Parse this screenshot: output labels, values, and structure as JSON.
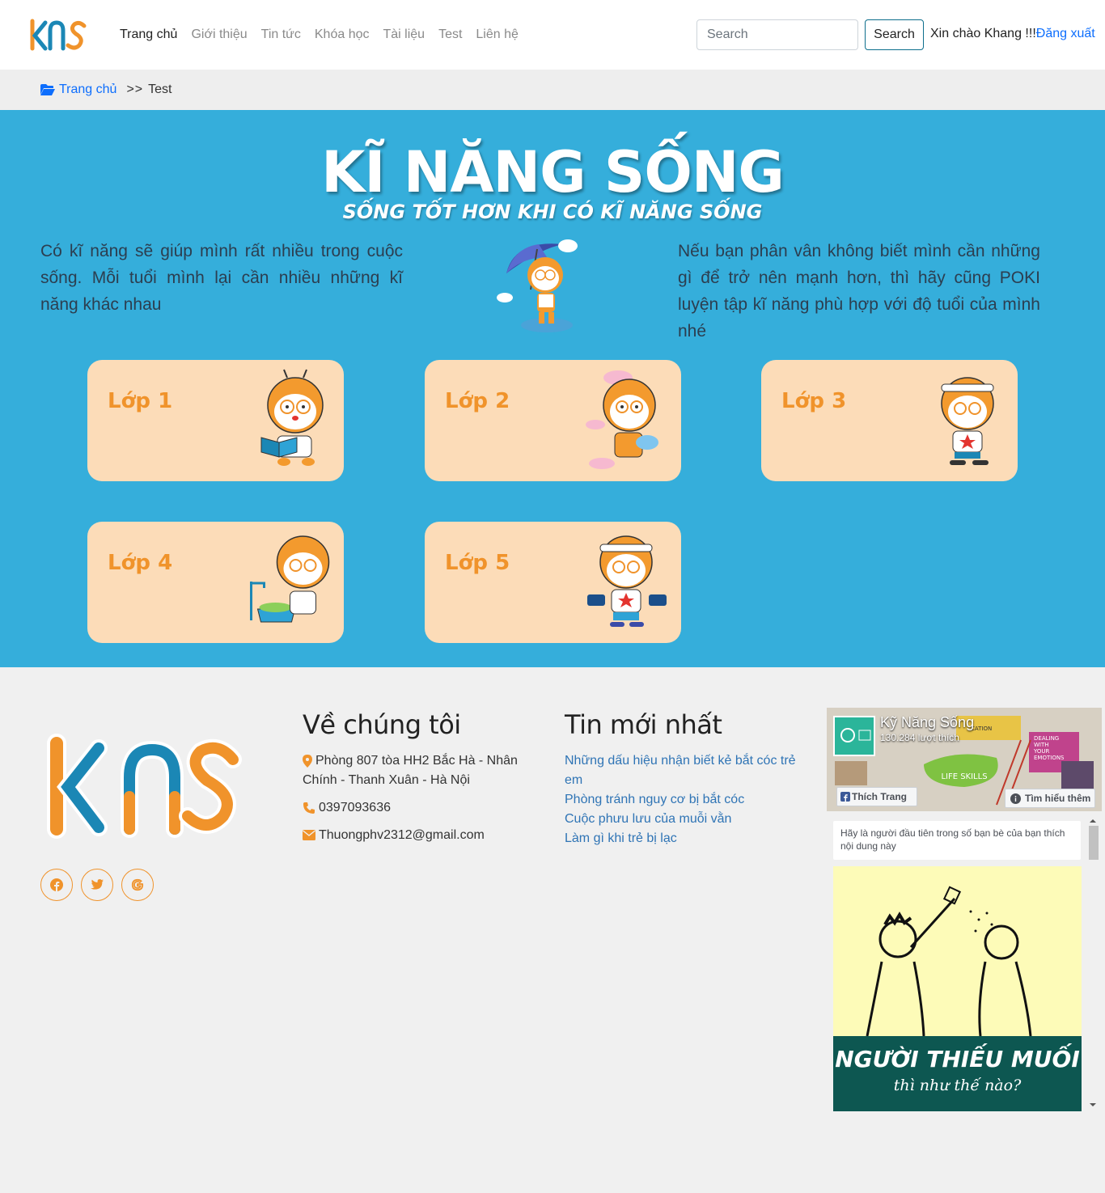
{
  "nav": {
    "links": [
      "Trang chủ",
      "Giới thiệu",
      "Tin tức",
      "Khóa học",
      "Tài liệu",
      "Test",
      "Liên hệ"
    ],
    "search_placeholder": "Search",
    "search_button": "Search",
    "greeting": "Xin chào Khang !!!",
    "logout": "Đăng xuất"
  },
  "breadcrumb": {
    "home": "Trang chủ",
    "separator": ">>",
    "current": "Test"
  },
  "hero": {
    "title": "KĨ NĂNG SỐNG",
    "subtitle": "SỐNG TỐT HƠN KHI CÓ KĨ NĂNG SỐNG",
    "left_text": "Có kĩ năng sẽ giúp mình rất nhiều trong cuộc sống. Mỗi tuổi mình lại cần nhiều những kĩ năng khác nhau",
    "right_text": "Nếu bạn phân vân không biết mình cần những gì để trở nên mạnh hơn, thì hãy cũng POKI luyện tập kĩ năng phù hợp với độ tuổi của mình nhé"
  },
  "classes": [
    "Lớp 1",
    "Lớp 2",
    "Lớp 3",
    "Lớp 4",
    "Lớp 5"
  ],
  "footer": {
    "about_title": "Về chúng tôi",
    "address": "Phòng 807 tòa HH2 Bắc Hà - Nhân Chính - Thanh Xuân - Hà Nội",
    "phone": "0397093636",
    "email": "Thuongphv2312@gmail.com",
    "news_title": "Tin mới nhất",
    "news": [
      "Những dấu hiệu nhận biết kẻ bắt cóc trẻ em",
      "Phòng tránh nguy cơ bị bắt cóc",
      "Cuộc phưu lưu của muỗi vằn",
      "Làm gì khi trẻ bị lạc"
    ]
  },
  "facebook": {
    "page_name": "Kỹ Năng Sống",
    "likes": "130.284 lượt thích",
    "like_button": "Thích Trang",
    "learn_more": "Tìm hiểu thêm",
    "friend_note": "Hãy là người đầu tiên trong số bạn bè của bạn thích nội dung này",
    "post_title": "NGƯỜI THIẾU MUỐI",
    "post_subtitle": "thì như thế nào?"
  },
  "colors": {
    "hero_bg": "#35aedb",
    "card_bg": "#fcdcb8",
    "accent_orange": "#f0932b",
    "link_blue": "#0d6efd"
  }
}
